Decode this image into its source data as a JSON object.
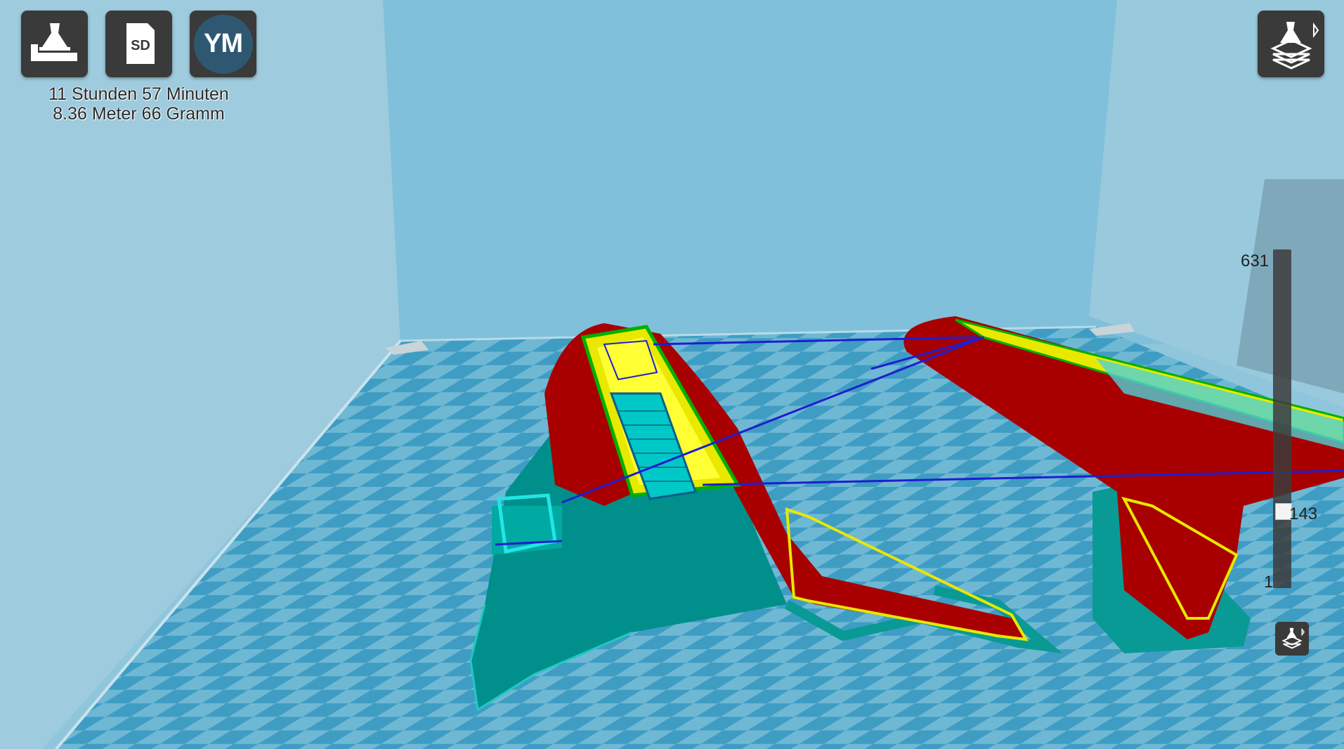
{
  "toolbar": {
    "print_button": {
      "icon": "printer-nozzle-icon"
    },
    "sd_button": {
      "icon": "sd-card-icon",
      "label": "SD"
    },
    "account_button": {
      "initials": "YM",
      "color": "#2e5872"
    }
  },
  "print_info": {
    "time": "11 Stunden 57 Minuten",
    "material": "8.36 Meter 66 Gramm"
  },
  "view_mode_button": {
    "icon": "layer-view-icon"
  },
  "layer_slider": {
    "max": "631",
    "current": "143",
    "min": "1",
    "current_fraction": 0.227
  },
  "small_view_button": {
    "icon": "layer-view-icon"
  },
  "colors": {
    "outer_wall": "#a80000",
    "inner_wall": "#00b000",
    "infill": "#e8e800",
    "skin": "#ffff33",
    "support": "#00e0e0",
    "support_dark": "#008f8a",
    "travel": "#1e1ed0",
    "build_plate_light": "#6fb8d4",
    "build_plate_dark": "#3f9dc4",
    "background": "#8fc6dc"
  }
}
